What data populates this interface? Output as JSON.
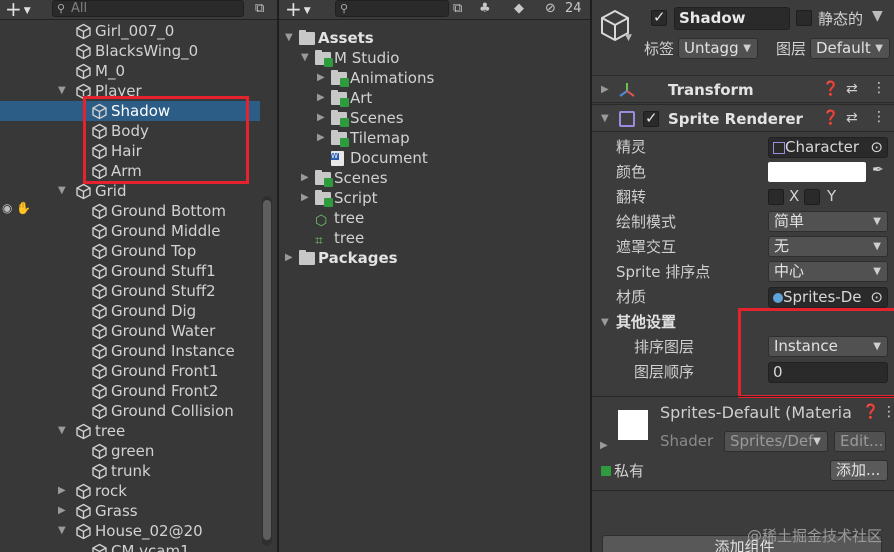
{
  "hierarchy": {
    "search_placeholder": "All",
    "rows": [
      "Girl_007_0",
      "BlacksWing_0",
      "M_0",
      "Player",
      "Shadow",
      "Body",
      "Hair",
      "Arm",
      "Grid",
      "Ground Bottom",
      "Ground Middle",
      "Ground Top",
      "Ground Stuff1",
      "Ground Stuff2",
      "Ground Dig",
      "Ground Water",
      "Ground Instance",
      "Ground Front1",
      "Ground Front2",
      "Ground Collision",
      "tree",
      "green",
      "trunk",
      "rock",
      "Grass",
      "House_02@20",
      "CM vcam1"
    ]
  },
  "project": {
    "badge_count": "24",
    "rows": [
      "Assets",
      "M Studio",
      "Animations",
      "Art",
      "Scenes",
      "Tilemap",
      "Document",
      "Scenes",
      "Script",
      "tree",
      "tree",
      "Packages"
    ]
  },
  "inspector": {
    "object_name": "Shadow",
    "static_label": "静态的",
    "tag_label": "标签",
    "tag_value": "Untagg",
    "layer_label": "图层",
    "layer_value": "Default",
    "transform_title": "Transform",
    "sprite_renderer_title": "Sprite Renderer",
    "sprite_label": "精灵",
    "sprite_value": "Character",
    "color_label": "颜色",
    "flip_label": "翻转",
    "flip_x": "X",
    "flip_y": "Y",
    "draw_mode_label": "绘制模式",
    "draw_mode_value": "简单",
    "mask_label": "遮罩交互",
    "mask_value": "无",
    "sort_point_label": "Sprite 排序点",
    "sort_point_value": "中心",
    "material_label": "材质",
    "material_value": "Sprites-De",
    "other_settings": "其他设置",
    "sorting_layer_label": "排序图层",
    "sorting_layer_value": "Instance",
    "order_label": "图层顺序",
    "order_value": "0",
    "material_asset": "Sprites-Default (Materia",
    "shader_label": "Shader",
    "shader_value": "Sprites/Def",
    "edit_button": "Edit...",
    "private_label": "私有",
    "add_button": "添加...",
    "add_component_button": "添加组件"
  },
  "watermark": "@稀土掘金技术社区",
  "colors": {
    "selection": "#2c5d87",
    "highlight_box": "#e5222e",
    "check_green": "#2e9b3e"
  }
}
